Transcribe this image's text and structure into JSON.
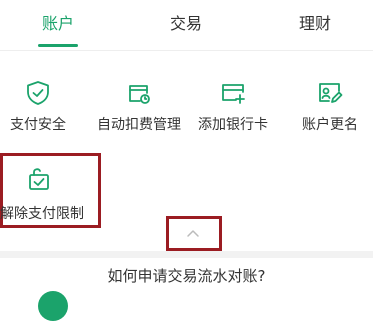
{
  "tabs": [
    {
      "label": "账户",
      "active": true
    },
    {
      "label": "交易",
      "active": false
    },
    {
      "label": "理财",
      "active": false
    }
  ],
  "accent_color": "#1ba36b",
  "highlight_color": "#9b1c22",
  "services": [
    {
      "label": "支付安全",
      "icon": "shield-check-icon"
    },
    {
      "label": "自动扣费管理",
      "icon": "auto-debit-icon"
    },
    {
      "label": "添加银行卡",
      "icon": "add-card-icon"
    },
    {
      "label": "账户更名",
      "icon": "rename-account-icon"
    },
    {
      "label": "解除支付限制",
      "icon": "unlock-payment-limit-icon"
    }
  ],
  "collapse_icon": "chevron-up-icon",
  "faq": {
    "title": "如何申请交易流水对账?"
  }
}
